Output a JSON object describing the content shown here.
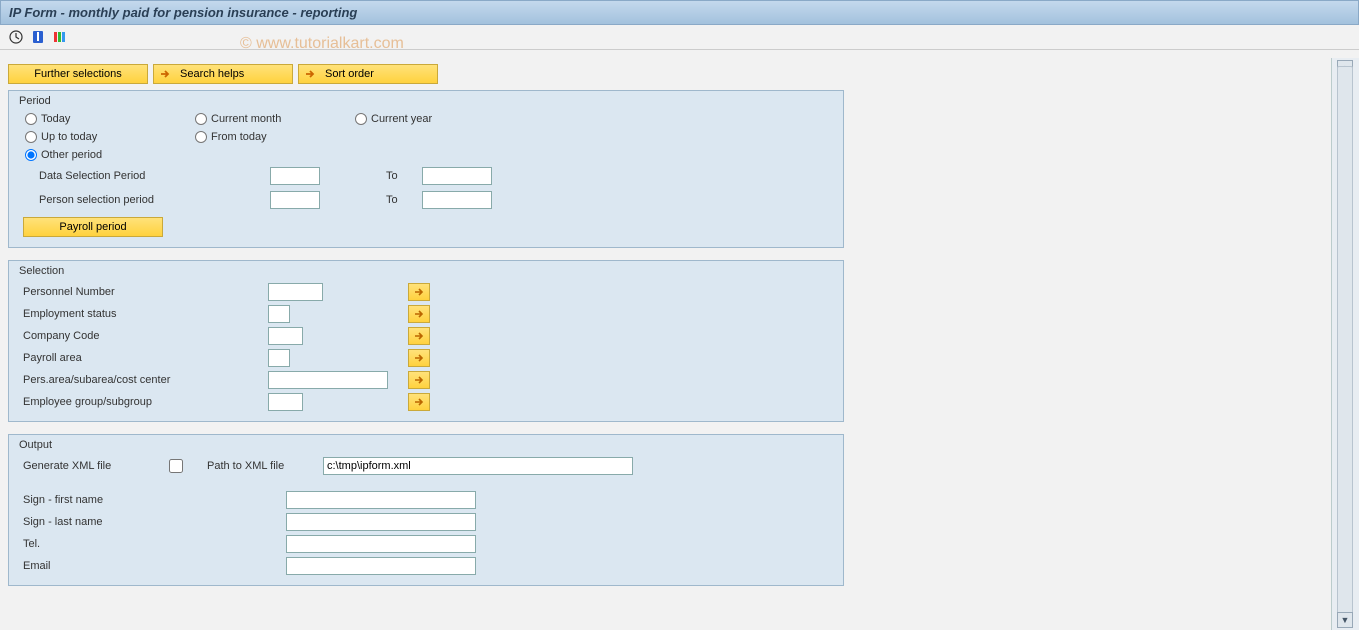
{
  "title": "IP Form - monthly paid for pension insurance - reporting",
  "watermark": "© www.tutorialkart.com",
  "buttons": {
    "further_selections": "Further selections",
    "search_helps": "Search helps",
    "sort_order": "Sort order",
    "payroll_period": "Payroll period"
  },
  "period": {
    "title": "Period",
    "today": "Today",
    "current_month": "Current month",
    "current_year": "Current year",
    "up_to_today": "Up to today",
    "from_today": "From today",
    "other_period": "Other period",
    "data_selection_period": "Data Selection Period",
    "person_selection_period": "Person selection period",
    "to": "To"
  },
  "selection": {
    "title": "Selection",
    "personnel_number": "Personnel Number",
    "employment_status": "Employment status",
    "company_code": "Company Code",
    "payroll_area": "Payroll area",
    "pers_area": "Pers.area/subarea/cost center",
    "employee_group": "Employee group/subgroup"
  },
  "output": {
    "title": "Output",
    "generate_xml": "Generate XML file",
    "path_xml_label": "Path to XML file",
    "path_xml_value": "c:\\tmp\\ipform.xml",
    "sign_first": "Sign - first name",
    "sign_last": "Sign - last name",
    "tel": "Tel.",
    "email": "Email"
  }
}
